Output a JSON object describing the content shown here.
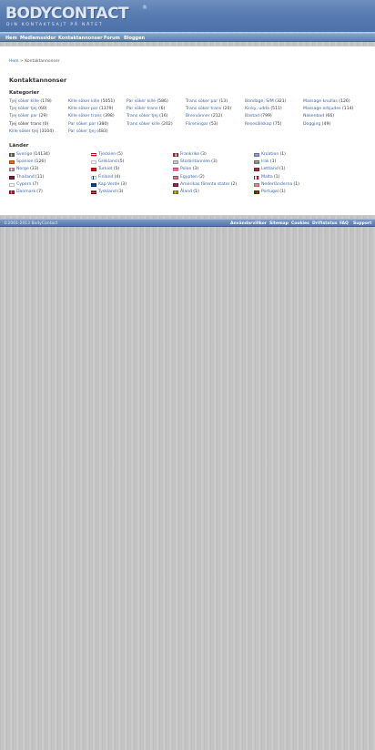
{
  "header": {
    "logo": "BODYCONTACT",
    "logo_mark": "®",
    "tagline": "DIN KONTAKTSAJT PÅ NÄTET"
  },
  "nav": [
    "Hem",
    "Medlemssidor",
    "Kontaktannonser",
    "Forum",
    "Bloggen"
  ],
  "breadcrumb": {
    "home": "Hem",
    "separator": " > ",
    "current": "Kontaktannonser"
  },
  "page_title": "Kontaktannonser",
  "categories_title": "Kategorier",
  "categories": [
    [
      {
        "label": "Tjej söker kille",
        "count": "(178)",
        "link": true
      },
      {
        "label": "Tjej söker tjej",
        "count": "(60)",
        "link": true
      },
      {
        "label": "Tjej söker par",
        "count": "(29)",
        "link": true
      },
      {
        "label": "Tjej söker trans",
        "count": "(0)",
        "link": false
      },
      {
        "label": "Kille söker tjej",
        "count": "(3104)",
        "link": true
      }
    ],
    [
      {
        "label": "Kille söker kille",
        "count": "(5051)",
        "link": true
      },
      {
        "label": "Kille söker par",
        "count": "(1379)",
        "link": true
      },
      {
        "label": "Kille söker trans",
        "count": "(398)",
        "link": true
      },
      {
        "label": "Par söker par",
        "count": "(380)",
        "link": true
      },
      {
        "label": "Par söker tjej",
        "count": "(483)",
        "link": true
      }
    ],
    [
      {
        "label": "Par söker kille",
        "count": "(586)",
        "link": true
      },
      {
        "label": "Par söker trans",
        "count": "(6)",
        "link": true
      },
      {
        "label": "Trans söker tjej",
        "count": "(16)",
        "link": true
      },
      {
        "label": "Trans söker kille",
        "count": "(202)",
        "link": true
      }
    ],
    [
      {
        "label": "Trans söker par",
        "count": "(13)",
        "link": true
      },
      {
        "label": "Trans söker trans",
        "count": "(20)",
        "link": true
      },
      {
        "label": "Brevvänner",
        "count": "(212)",
        "link": true
      },
      {
        "label": "Föreningar",
        "count": "(53)",
        "link": true
      }
    ],
    [
      {
        "label": "Bondage, S/M",
        "count": "(321)",
        "link": true
      },
      {
        "label": "Kinky, udda",
        "count": "(511)",
        "link": true
      },
      {
        "label": "Bastad",
        "count": "(799)",
        "link": true
      },
      {
        "label": "Resesällskap",
        "count": "(75)",
        "link": true
      }
    ],
    [
      {
        "label": "Massage knullas",
        "count": "(126)",
        "link": true
      },
      {
        "label": "Massage erbjudes",
        "count": "(114)",
        "link": true
      },
      {
        "label": "Nakenbad",
        "count": "(66)",
        "link": true
      },
      {
        "label": "Dogging",
        "count": "(49)",
        "link": true
      }
    ]
  ],
  "countries_title": "Länder",
  "countries": [
    [
      {
        "name": "Sverige",
        "count": "(14134)",
        "flag": "se"
      },
      {
        "name": "Spanien",
        "count": "(126)",
        "flag": "es"
      },
      {
        "name": "Norge",
        "count": "(33)",
        "flag": "no"
      },
      {
        "name": "Thailand",
        "count": "(11)",
        "flag": "th"
      },
      {
        "name": "Cypern",
        "count": "(7)",
        "flag": "cy"
      },
      {
        "name": "Danmark",
        "count": "(7)",
        "flag": "dk"
      }
    ],
    [
      {
        "name": "Tjeckien",
        "count": "(5)",
        "flag": "cz"
      },
      {
        "name": "Grekland",
        "count": "(5)",
        "flag": "gr"
      },
      {
        "name": "Turkiet",
        "count": "(5)",
        "flag": "tr"
      },
      {
        "name": "Finland",
        "count": "(4)",
        "flag": "fi"
      },
      {
        "name": "Kap Verde",
        "count": "(3)",
        "flag": "cv"
      },
      {
        "name": "Tyskland",
        "count": "(3)",
        "flag": "de"
      }
    ],
    [
      {
        "name": "Frankrike",
        "count": "(3)",
        "flag": "fr"
      },
      {
        "name": "Storbritannien",
        "count": "(3)",
        "flag": "gb"
      },
      {
        "name": "Polen",
        "count": "(3)",
        "flag": "pl"
      },
      {
        "name": "Egypten",
        "count": "(2)",
        "flag": "eg"
      },
      {
        "name": "Amerikas förenta stater",
        "count": "(2)",
        "flag": "us"
      },
      {
        "name": "Åland",
        "count": "(1)",
        "flag": "ax"
      }
    ],
    [
      {
        "name": "Kroatien",
        "count": "(1)",
        "flag": "hr"
      },
      {
        "name": "Irak",
        "count": "(1)",
        "flag": "iq"
      },
      {
        "name": "Lettland",
        "count": "(1)",
        "flag": "lv"
      },
      {
        "name": "Malta",
        "count": "(1)",
        "flag": "mt"
      },
      {
        "name": "Nederländerna",
        "count": "(1)",
        "flag": "nl"
      },
      {
        "name": "Portugal",
        "count": "(1)",
        "flag": "pt"
      }
    ]
  ],
  "flags": {
    "se": "linear-gradient(90deg, transparent 30%, #f2c200 30%, #f2c200 45%, transparent 45%), linear-gradient(180deg, #3a6fb5 40%, #f2c200 40%, #f2c200 60%, #3a6fb5 60%)",
    "es": "linear-gradient(180deg, #c8102e 25%, #f6c500 25%, #f6c500 75%, #c8102e 75%)",
    "no": "linear-gradient(90deg, transparent 28%, #fff 28%, #fff 32%, #1e3a8a 32%, #1e3a8a 40%, #fff 40%, #fff 44%, transparent 44%), linear-gradient(180deg, #c8102e 36%, #fff 36%, #fff 42%, #1e3a8a 42%, #1e3a8a 58%, #fff 58%, #fff 64%, #c8102e 64%)",
    "th": "linear-gradient(180deg, #c8102e 17%, #fff 17%, #fff 33%, #2d2a5f 33%, #2d2a5f 67%, #fff 67%, #fff 83%, #c8102e 83%)",
    "cy": "linear-gradient(180deg, #fafafa, #fafafa)",
    "dk": "linear-gradient(90deg, transparent 30%, #fff 30%, #fff 42%, transparent 42%), linear-gradient(180deg, #c8102e 42%, #fff 42%, #fff 58%, #c8102e 58%)",
    "cz": "linear-gradient(180deg, #fff 50%, #d7141a 50%)",
    "gr": "repeating-linear-gradient(180deg, #0d5eaf 0 11%, #fff 11% 22%)",
    "tr": "linear-gradient(180deg, #e30a17, #e30a17)",
    "fi": "linear-gradient(90deg, transparent 30%, #003580 30%, #003580 44%, transparent 44%), linear-gradient(180deg, #fff 40%, #003580 40%, #003580 60%, #fff 60%)",
    "cv": "linear-gradient(180deg, #003893 55%, #fff 55%, #fff 62%, #cf2027 62%, #cf2027 68%, #fff 68%, #fff 75%, #003893 75%)",
    "de": "linear-gradient(180deg, #000 33%, #dd0000 33%, #dd0000 66%, #ffce00 66%)",
    "fr": "linear-gradient(90deg, #0055a4 33%, #fff 33%, #fff 66%, #ef4135 66%)",
    "gb": "linear-gradient(180deg, #b8c6e0, #d7c6cf)",
    "pl": "linear-gradient(180deg, #fff 50%, #dc143c 50%)",
    "eg": "linear-gradient(180deg, #ce1126 33%, #fff 33%, #fff 66%, #000 66%)",
    "us": "linear-gradient(90deg, #3c3b6e 40%, transparent 40%), repeating-linear-gradient(180deg, #b22234 0 14%, #fff 14% 28%)",
    "ax": "linear-gradient(90deg, transparent 30%, #f2c200 30%, #f2c200 34%, #d21034 34%, #d21034 42%, #f2c200 42%, #f2c200 46%, transparent 46%), linear-gradient(180deg, #0064ad 36%, #f2c200 36%, #f2c200 42%, #d21034 42%, #d21034 58%, #f2c200 58%, #f2c200 64%, #0064ad 64%)",
    "hr": "linear-gradient(180deg, #ff0000 33%, #fff 33%, #fff 66%, #171796 66%)",
    "iq": "linear-gradient(180deg, #ce1126 33%, #fff 33%, #fff 66%, #000 66%)",
    "lv": "linear-gradient(180deg, #9e3039 40%, #fff 40%, #fff 60%, #9e3039 60%)",
    "mt": "linear-gradient(90deg, #fff 50%, #cf142b 50%)",
    "nl": "linear-gradient(180deg, #ae1c28 33%, #fff 33%, #fff 66%, #21468b 66%)",
    "pt": "linear-gradient(90deg, #006600 40%, #ff0000 40%)"
  },
  "footer": {
    "copyright": "©2001-2013 BodyContact",
    "links": [
      "Användarvillkor",
      "Sitemap",
      "Cookies",
      "Driftstatus",
      "FAQ",
      "Support"
    ]
  }
}
